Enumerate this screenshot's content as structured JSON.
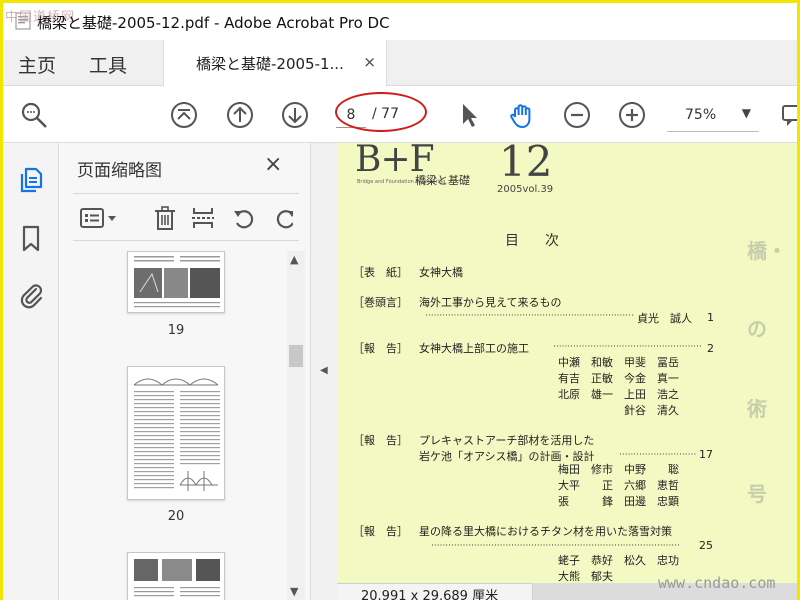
{
  "window": {
    "title": "橋梁と基礎-2005-12.pdf - Adobe Acrobat Pro DC",
    "watermark_top": "中国道桥网"
  },
  "tabs": {
    "home": "主页",
    "tools": "工具",
    "document": "橋梁と基礎-2005-1...",
    "close": "×"
  },
  "toolbar": {
    "current_page": "8",
    "total_pages": "/ 77",
    "zoom": "75%"
  },
  "thumbnails_panel": {
    "title": "页面缩略图",
    "close": "×",
    "pages": [
      {
        "label": "19"
      },
      {
        "label": "20"
      }
    ]
  },
  "document": {
    "logo": "B+F",
    "logo_subtitle": "Bridge and Foundation Engineering",
    "logo_japanese": "橋梁と基礎",
    "issue_number": "12",
    "issue_volume": "2005vol.39",
    "toc_heading": "目次",
    "entries": [
      {
        "category": "［表　紙］",
        "title": "女神大橋",
        "author": "",
        "page": ""
      },
      {
        "category": "［巻頭言］",
        "title": "海外工事から見えて来るもの",
        "author": "貞光　誠人",
        "page": "1"
      },
      {
        "category": "［報　告］",
        "title": "女神大橋上部工の施工",
        "author": "",
        "page": "2",
        "authors_block": "中瀬　和敏　甲斐　冨岳\n有吉　正敏　今金　真一\n北原　雄一　上田　浩之\n　　　　　　針谷　清久"
      },
      {
        "category": "［報　告］",
        "title": "プレキャストアーチ部材を活用した",
        "title2": "岩ケ池「オアシス橋」の計画・設計",
        "author": "",
        "page": "17",
        "authors_block": "梅田　修市　中野　　聡\n大平　　正　六郷　恵哲\n張　　　鋒　田邊　忠顕"
      },
      {
        "category": "［報　告］",
        "title": "星の降る里大橋におけるチタン材を用いた落雪対策",
        "author": "",
        "page": "25",
        "authors_block": "蛯子　恭好　松久　忠功\n大熊　郁夫"
      }
    ],
    "page_dimensions": "20.991 x 29.689 厘米"
  },
  "watermark_bottom": "www.cndao.com",
  "colors": {
    "accent_blue": "#1473e6",
    "annotation_red": "#d21a1a",
    "page_tint": "#f3f9c3",
    "frame_yellow": "#f2e500"
  }
}
